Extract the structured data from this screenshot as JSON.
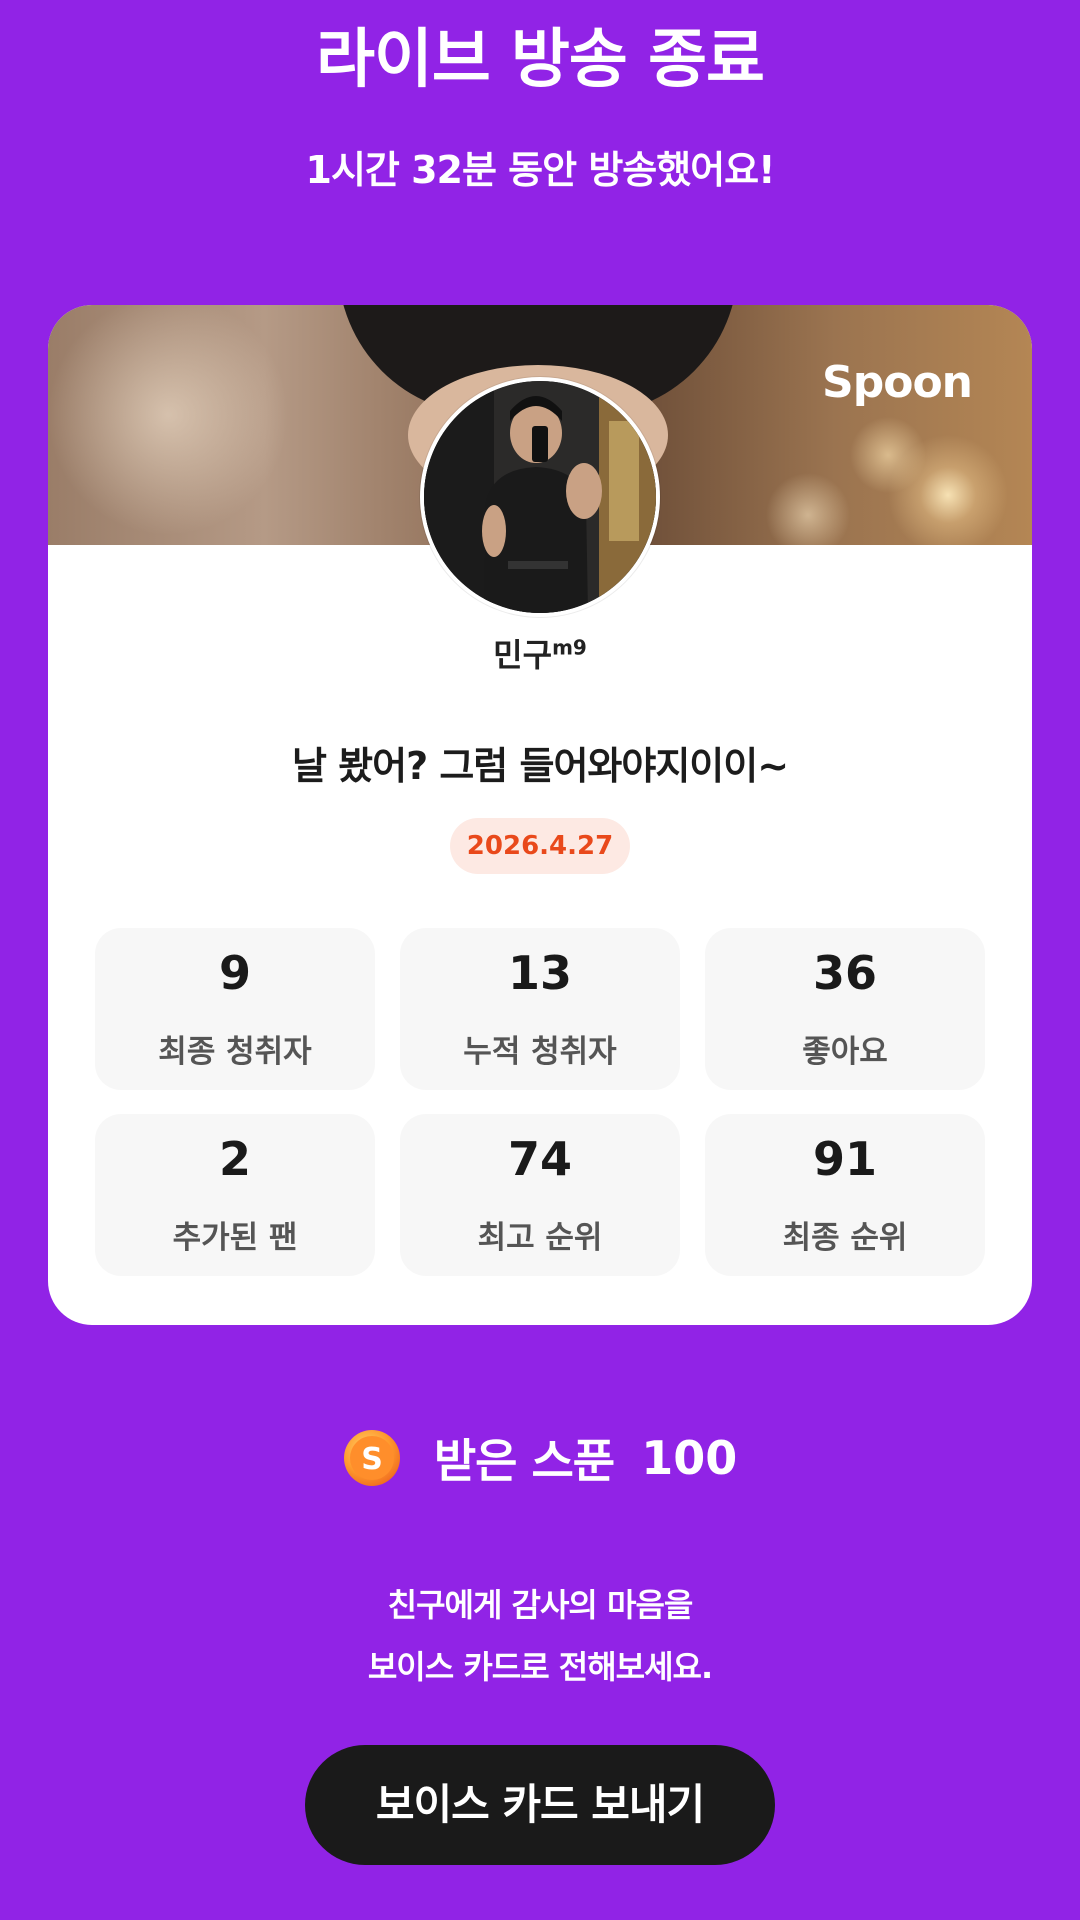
{
  "header": {
    "title": "라이브 방송 종료",
    "duration_text": "1시간 32분 동안 방송했어요!"
  },
  "card": {
    "brand": "Spoon",
    "username": "민구",
    "username_sup": "m9",
    "live_title": "날 봤어? 그럼 들어와야지이이~",
    "date": "2026.4.27",
    "stats": [
      {
        "value": "9",
        "label": "최종 청취자"
      },
      {
        "value": "13",
        "label": "누적 청취자"
      },
      {
        "value": "36",
        "label": "좋아요"
      },
      {
        "value": "2",
        "label": "추가된 팬"
      },
      {
        "value": "74",
        "label": "최고 순위"
      },
      {
        "value": "91",
        "label": "최종 순위"
      }
    ]
  },
  "spoons": {
    "icon": "spoon-coin-icon",
    "label": "받은 스푼",
    "count": "100"
  },
  "message": {
    "line1": "친구에게 감사의 마음을",
    "line2": "보이스 카드로 전해보세요."
  },
  "cta": {
    "label": "보이스 카드 보내기"
  },
  "colors": {
    "background": "#9123e6",
    "date_badge_text": "#e9491b",
    "date_badge_bg": "#fde9e3",
    "button_bg": "#1a1a1a"
  }
}
